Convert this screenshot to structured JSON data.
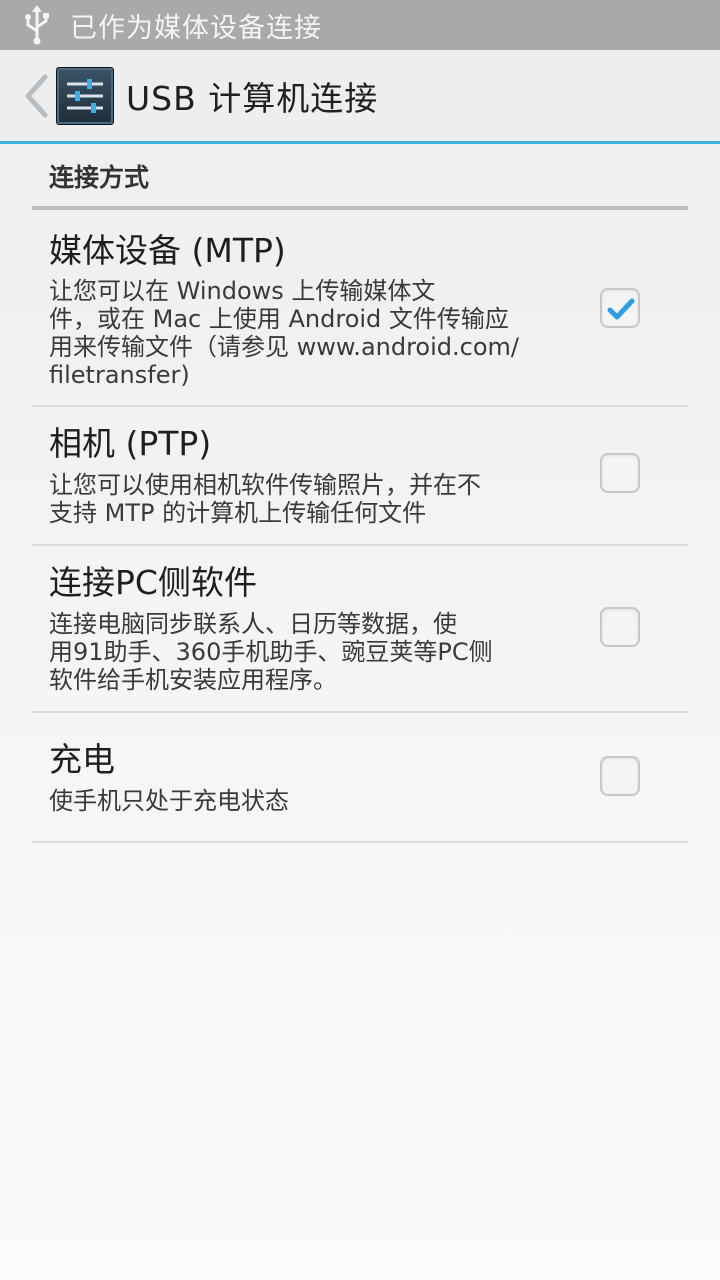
{
  "status_bar": {
    "usb_icon": "usb-icon",
    "text": "已作为媒体设备连接"
  },
  "action_bar": {
    "back_icon": "chevron-left-icon",
    "app_icon": "settings-sliders-icon",
    "title": "USB 计算机连接"
  },
  "section": {
    "header": "连接方式"
  },
  "options": [
    {
      "title": "媒体设备 (MTP)",
      "desc_lines": [
        "让您可以在 Windows 上传输媒体文",
        "件，或在 Mac 上使用 Android 文件传输应",
        "用来传输文件（请参见 www.android.com/",
        "filetransfer)"
      ],
      "checked": true
    },
    {
      "title": "相机 (PTP)",
      "desc_lines": [
        "让您可以使用相机软件传输照片，并在不",
        "支持 MTP 的计算机上传输任何文件"
      ],
      "checked": false
    },
    {
      "title": "连接PC侧软件",
      "desc_lines": [
        "连接电脑同步联系人、日历等数据，使",
        "用91助手、360手机助手、豌豆荚等PC侧",
        "软件给手机安装应用程序。"
      ],
      "checked": false
    },
    {
      "title": "充电",
      "desc_lines": [
        "使手机只处于充电状态"
      ],
      "checked": false
    }
  ],
  "colors": {
    "accent": "#3fb0e0",
    "check": "#2f9fe0",
    "status_bar": "#a9a9a9"
  }
}
